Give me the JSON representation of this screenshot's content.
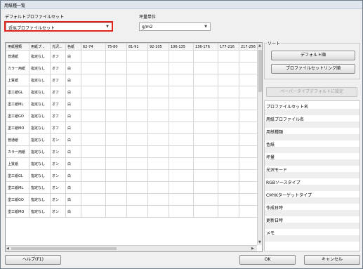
{
  "window": {
    "title": "用紙種一覧"
  },
  "default_profile_set": {
    "label": "デフォルトプロファイルセット",
    "value": "近似プロファイルセット"
  },
  "weight_unit": {
    "label": "坪量単位",
    "value": "g/m2"
  },
  "table": {
    "columns": [
      "用紙種類",
      "用紙プ...",
      "光沢...",
      "色紙",
      "62-74",
      "75-80",
      "81-91",
      "92-105",
      "106-135",
      "136-176",
      "177-216",
      "217-256"
    ],
    "rows": [
      [
        "普通紙",
        "指定なし",
        "オフ",
        "白"
      ],
      [
        "カラー用紙",
        "指定なし",
        "オフ",
        "白"
      ],
      [
        "上質紙",
        "指定なし",
        "オフ",
        "白"
      ],
      [
        "塗工紙GL",
        "指定なし",
        "オフ",
        "白"
      ],
      [
        "塗工紙ML",
        "指定なし",
        "オフ",
        "白"
      ],
      [
        "塗工紙GO",
        "指定なし",
        "オフ",
        "白"
      ],
      [
        "塗工紙MO",
        "指定なし",
        "オフ",
        "白"
      ],
      [
        "普通紙",
        "指定なし",
        "オン",
        "白"
      ],
      [
        "カラー用紙",
        "指定なし",
        "オン",
        "白"
      ],
      [
        "上質紙",
        "指定なし",
        "オン",
        "白"
      ],
      [
        "塗工紙GL",
        "指定なし",
        "オン",
        "白"
      ],
      [
        "塗工紙ML",
        "指定なし",
        "オン",
        "白"
      ],
      [
        "塗工紙GO",
        "指定なし",
        "オン",
        "白"
      ],
      [
        "塗工紙MO",
        "指定なし",
        "オン",
        "白"
      ]
    ]
  },
  "sort": {
    "label": "ソート",
    "default_order": "デフォルト順",
    "profile_link_order": "プロファイルセットリンク順"
  },
  "set_default_button": "ペーパータイプデフォルトに設定",
  "properties": [
    "プロファイルセット名",
    "用紙プロファイル名",
    "用紙種類",
    "色紙",
    "坪量",
    "光沢モード",
    "RGBソースタイプ",
    "CMYKターゲットタイプ",
    "作成日時",
    "更新日時",
    "メモ"
  ],
  "buttons": {
    "help": "ヘルプ(F1)",
    "ok": "OK",
    "cancel": "キャンセル"
  }
}
